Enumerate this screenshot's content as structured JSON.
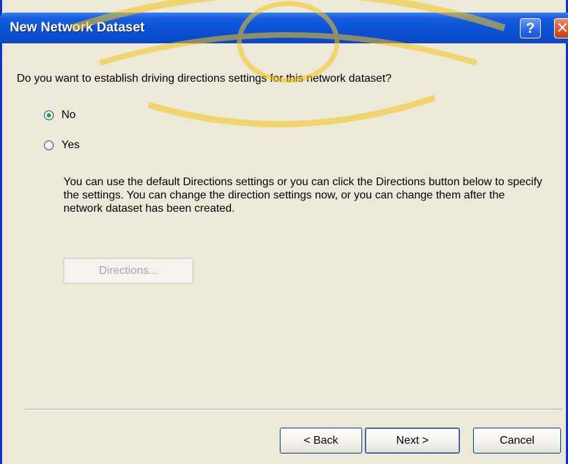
{
  "window": {
    "title": "New Network Dataset",
    "help_label": "?",
    "close_label": "✕"
  },
  "main": {
    "question": "Do you want to establish driving directions settings for this network dataset?",
    "options": [
      {
        "label": "No",
        "selected": true
      },
      {
        "label": "Yes",
        "selected": false
      }
    ],
    "info": "You can use the default Directions settings or you can click the Directions button below to specify the settings. You can change the direction settings now, or you can change them after the network dataset has been created.",
    "directions_button": "Directions..."
  },
  "footer": {
    "back_button": "< Back",
    "next_button": "Next >",
    "cancel_button": "Cancel"
  },
  "colors": {
    "titlebar": "#0a55d8",
    "dialog_bg": "#ece9d8",
    "watermark": "#f5c518"
  }
}
